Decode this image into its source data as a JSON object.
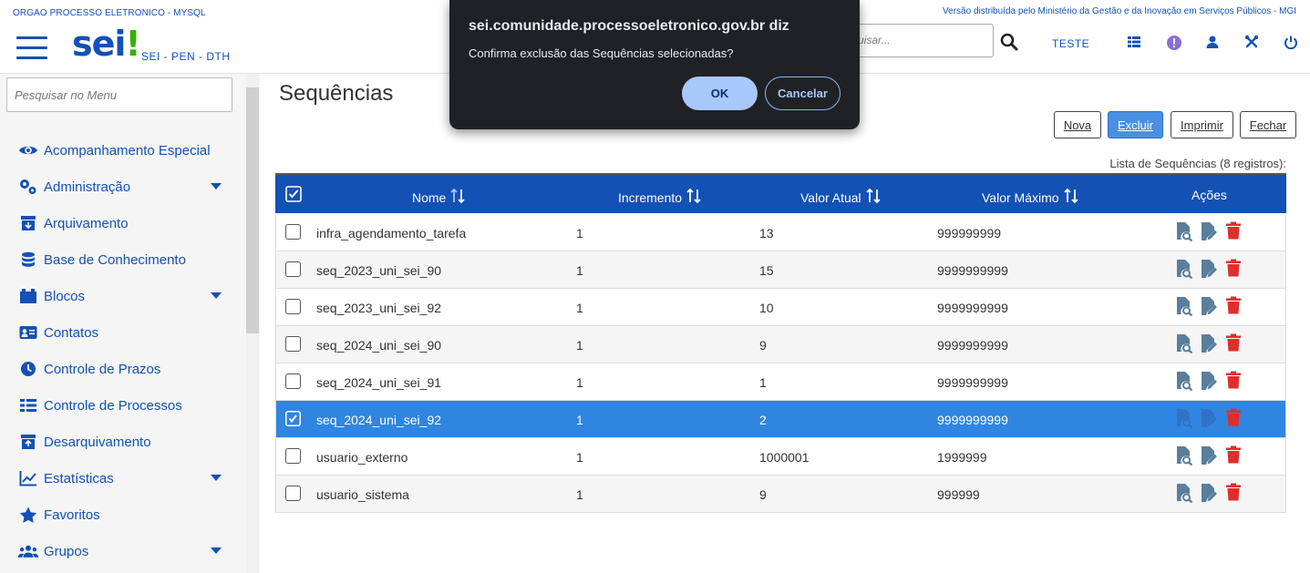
{
  "header": {
    "org_label": "ORGAO PROCESSO ELETRONICO - MYSQL",
    "gov_label": "Versão distribuída pelo Ministério da Gestão e da Inovação em Serviços Públicos - MGI",
    "logo_text": "sei",
    "logo_mark": "!",
    "subsystem": "SEI - PEN - DTH",
    "search_placeholder": "uisar...",
    "unit": "TESTE",
    "icons": [
      "menu-icon",
      "search-icon",
      "grid-icon",
      "alert-icon",
      "user-icon",
      "tools-icon",
      "power-icon"
    ]
  },
  "sidebar": {
    "search_placeholder": "Pesquisar no Menu",
    "items": [
      {
        "label": "Acompanhamento Especial",
        "icon": "eye-icon",
        "expandable": false
      },
      {
        "label": "Administração",
        "icon": "gears-icon",
        "expandable": true
      },
      {
        "label": "Arquivamento",
        "icon": "archive-icon",
        "expandable": false
      },
      {
        "label": "Base de Conhecimento",
        "icon": "database-icon",
        "expandable": false
      },
      {
        "label": "Blocos",
        "icon": "blocks-icon",
        "expandable": true
      },
      {
        "label": "Contatos",
        "icon": "contact-card-icon",
        "expandable": false
      },
      {
        "label": "Controle de Prazos",
        "icon": "clock-icon",
        "expandable": false
      },
      {
        "label": "Controle de Processos",
        "icon": "list-icon",
        "expandable": false
      },
      {
        "label": "Desarquivamento",
        "icon": "unarchive-icon",
        "expandable": false
      },
      {
        "label": "Estatísticas",
        "icon": "chart-icon",
        "expandable": true
      },
      {
        "label": "Favoritos",
        "icon": "star-icon",
        "expandable": false
      },
      {
        "label": "Grupos",
        "icon": "users-icon",
        "expandable": true
      }
    ]
  },
  "main": {
    "title": "Sequências",
    "buttons": {
      "nova": "Nova",
      "excluir": "Excluir",
      "imprimir": "Imprimir",
      "fechar": "Fechar"
    },
    "caption": "Lista de Sequências (8 registros):",
    "columns": [
      "Nome",
      "Incremento",
      "Valor Atual",
      "Valor Máximo",
      "Ações"
    ],
    "rows": [
      {
        "nome": "infra_agendamento_tarefa",
        "incremento": "1",
        "valor_atual": "13",
        "valor_maximo": "999999999",
        "selected": false
      },
      {
        "nome": "seq_2023_uni_sei_90",
        "incremento": "1",
        "valor_atual": "15",
        "valor_maximo": "9999999999",
        "selected": false
      },
      {
        "nome": "seq_2023_uni_sei_92",
        "incremento": "1",
        "valor_atual": "10",
        "valor_maximo": "9999999999",
        "selected": false
      },
      {
        "nome": "seq_2024_uni_sei_90",
        "incremento": "1",
        "valor_atual": "9",
        "valor_maximo": "9999999999",
        "selected": false
      },
      {
        "nome": "seq_2024_uni_sei_91",
        "incremento": "1",
        "valor_atual": "1",
        "valor_maximo": "9999999999",
        "selected": false
      },
      {
        "nome": "seq_2024_uni_sei_92",
        "incremento": "1",
        "valor_atual": "2",
        "valor_maximo": "9999999999",
        "selected": true
      },
      {
        "nome": "usuario_externo",
        "incremento": "1",
        "valor_atual": "1000001",
        "valor_maximo": "1999999",
        "selected": false
      },
      {
        "nome": "usuario_sistema",
        "incremento": "1",
        "valor_atual": "9",
        "valor_maximo": "999999",
        "selected": false
      }
    ]
  },
  "dialog": {
    "title": "sei.comunidade.processoeletronico.gov.br diz",
    "message": "Confirma exclusão das Sequências selecionadas?",
    "ok": "OK",
    "cancel": "Cancelar"
  },
  "colors": {
    "primary": "#1351b4",
    "selected_row": "#3085e0",
    "delete_red": "#e02d2d",
    "dialog_bg": "#202124"
  }
}
